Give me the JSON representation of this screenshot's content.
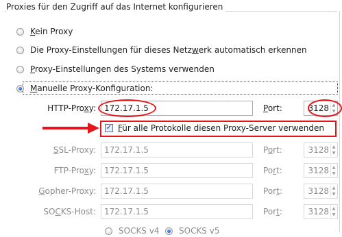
{
  "group": {
    "title": "Proxies für den Zugriff auf das Internet konfigurieren"
  },
  "radios": [
    {
      "pre": "",
      "acc": "K",
      "post": "ein Proxy",
      "checked": false
    },
    {
      "pre": "Die Proxy-Einstellungen für dieses Netz",
      "acc": "w",
      "post": "erk automatisch erkennen",
      "checked": false
    },
    {
      "pre": "",
      "acc": "P",
      "post": "roxy-Einstellungen des Systems verwenden",
      "checked": false
    },
    {
      "pre": "",
      "acc": "M",
      "post": "anuelle Proxy-Konfiguration:",
      "checked": true
    }
  ],
  "http": {
    "label_pre": "HTTP-Pro",
    "label_acc": "x",
    "label_post": "y:",
    "value": "172.17.1.5",
    "port_label_acc": "P",
    "port_label_post": "ort:",
    "port": "3128"
  },
  "share": {
    "checked_glyph": "✓",
    "label_acc": "F",
    "label_post": "ür alle Protokolle diesen Proxy-Server verwenden"
  },
  "rows": [
    {
      "label_pre": "",
      "label_acc": "S",
      "label_post": "SL-Proxy:",
      "value": "172.17.1.5",
      "port_pre": "P",
      "port_acc": "o",
      "port_post": "rt:",
      "port": "3128"
    },
    {
      "label_pre": "FTP-Pro",
      "label_acc": "x",
      "label_post": "y:",
      "value": "172.17.1.5",
      "port_pre": "Po",
      "port_acc": "r",
      "port_post": "t:",
      "port": "3128"
    },
    {
      "label_pre": "",
      "label_acc": "G",
      "label_post": "opher-Proxy:",
      "value": "172.17.1.5",
      "port_pre": "Por",
      "port_acc": "t",
      "port_post": ":",
      "port": "3128"
    },
    {
      "label_pre": "SO",
      "label_acc": "C",
      "label_post": "KS-Host:",
      "value": "172.17.1.5",
      "port_pre": "Por",
      "port_acc": "t",
      "port_post": ":",
      "port": "3128"
    }
  ],
  "socks": {
    "v4": "SOCKS v4",
    "v5": "SOCKS v5"
  },
  "colors": {
    "annotation_red": "#e3161c"
  },
  "icons": {
    "arrow": "right-arrow-icon"
  }
}
